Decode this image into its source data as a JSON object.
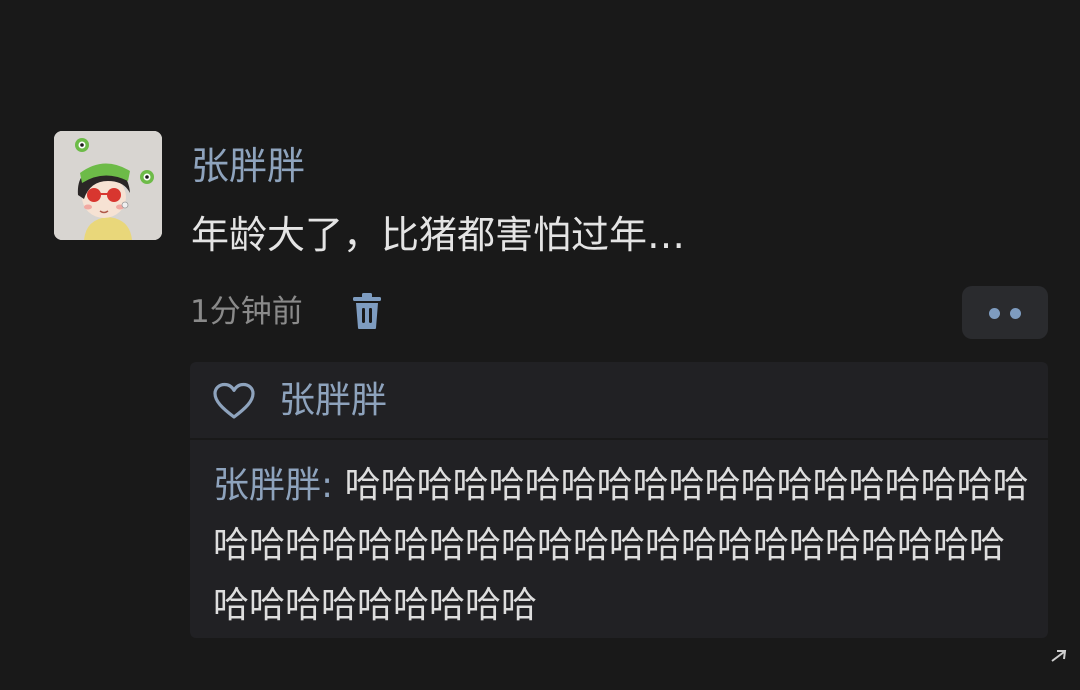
{
  "post": {
    "author": "张胖胖",
    "text": "年龄大了，比猪都害怕过年…",
    "timestamp": "1分钟前"
  },
  "likes": {
    "names": "张胖胖"
  },
  "reply": {
    "author": "张胖胖",
    "separator": ":",
    "text": " 哈哈哈哈哈哈哈哈哈哈哈哈哈哈哈哈哈哈哈哈哈哈哈哈哈哈哈哈哈哈哈哈哈哈哈哈哈哈哈哈哈哈哈哈哈哈哈哈哈哈"
  },
  "colors": {
    "background": "#191919",
    "name_link": "#8ea3bd",
    "body_text": "#e4e4e4",
    "muted_text": "#8a8a8a",
    "panel": "#212124",
    "accent_dot": "#7e9cc0"
  },
  "icons": {
    "delete": "trash-icon",
    "like": "heart-icon",
    "more": "more-dots-icon"
  }
}
